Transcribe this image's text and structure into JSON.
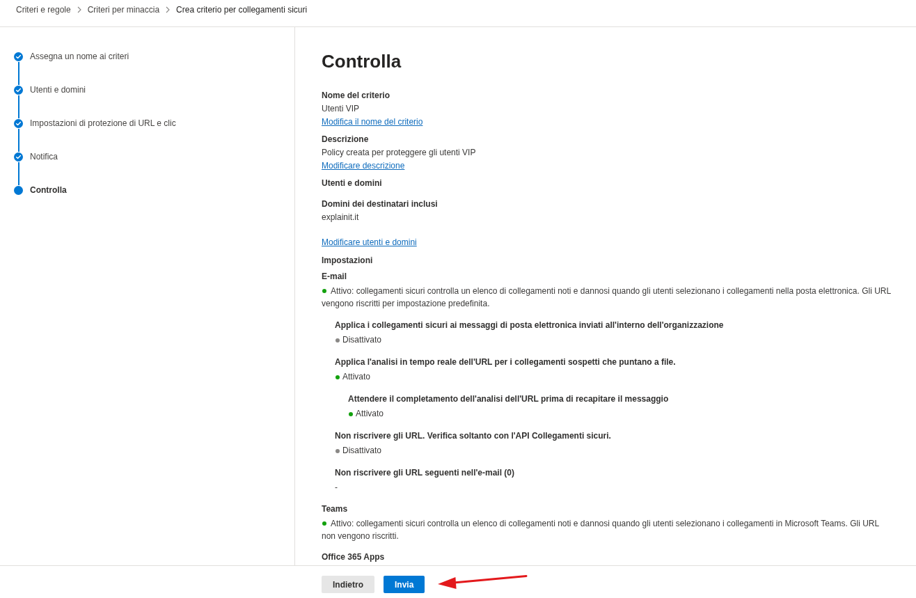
{
  "breadcrumb": [
    {
      "label": "Criteri e regole",
      "current": false
    },
    {
      "label": "Criteri per minaccia",
      "current": false
    },
    {
      "label": "Crea criterio per collegamenti sicuri",
      "current": true
    }
  ],
  "steps": [
    {
      "label": "Assegna un nome ai criteri",
      "done": true,
      "selected": false
    },
    {
      "label": "Utenti e domini",
      "done": true,
      "selected": false
    },
    {
      "label": "Impostazioni di protezione di URL e clic",
      "done": true,
      "selected": false
    },
    {
      "label": "Notifica",
      "done": true,
      "selected": false
    },
    {
      "label": "Controlla",
      "done": false,
      "selected": true
    }
  ],
  "review": {
    "title": "Controlla",
    "policy_name": {
      "heading": "Nome del criterio",
      "value": "Utenti VIP",
      "link": "Modifica il nome del criterio"
    },
    "description": {
      "heading": "Descrizione",
      "value": "Policy creata per proteggere gli utenti VIP",
      "link": "Modificare descrizione"
    },
    "users_domains": {
      "heading": "Utenti e domini",
      "subheading": "Domini dei destinatari inclusi",
      "value": "explainit.it",
      "link": "Modificare utenti e domini"
    },
    "settings": {
      "heading": "Impostazioni",
      "groups": [
        {
          "name": "E-mail",
          "active": true,
          "summary": "Attivo: collegamenti sicuri controlla un elenco di collegamenti noti e dannosi quando gli utenti selezionano i collegamenti nella posta elettronica. Gli URL vengono riscritti per impostazione predefinita.",
          "options": [
            {
              "kind": "toggle",
              "title": "Applica i collegamenti sicuri ai messaggi di posta elettronica inviati all'interno dell'organizzazione",
              "on": false,
              "status": "Disattivato"
            },
            {
              "kind": "toggle",
              "title": "Applica l'analisi in tempo reale dell'URL per i collegamenti sospetti che puntano a file.",
              "on": true,
              "status": "Attivato",
              "children": [
                {
                  "kind": "toggle",
                  "title": "Attendere il completamento dell'analisi dell'URL prima di recapitare il messaggio",
                  "on": true,
                  "status": "Attivato"
                }
              ]
            },
            {
              "kind": "toggle",
              "title": "Non riscrivere gli URL. Verifica soltanto con l'API Collegamenti sicuri.",
              "on": false,
              "status": "Disattivato"
            },
            {
              "kind": "list",
              "title": "Non riscrivere gli URL seguenti nell'e-mail (0)",
              "value": "-"
            }
          ]
        },
        {
          "name": "Teams",
          "active": true,
          "summary": "Attivo: collegamenti sicuri controlla un elenco di collegamenti noti e dannosi quando gli utenti selezionano i collegamenti in Microsoft Teams. Gli URL non vengono riscritti."
        },
        {
          "name": "Office 365 Apps"
        }
      ]
    }
  },
  "footer": {
    "buttons": [
      {
        "label": "Indietro",
        "kind": "secondary"
      },
      {
        "label": "Invia",
        "kind": "primary"
      }
    ]
  }
}
